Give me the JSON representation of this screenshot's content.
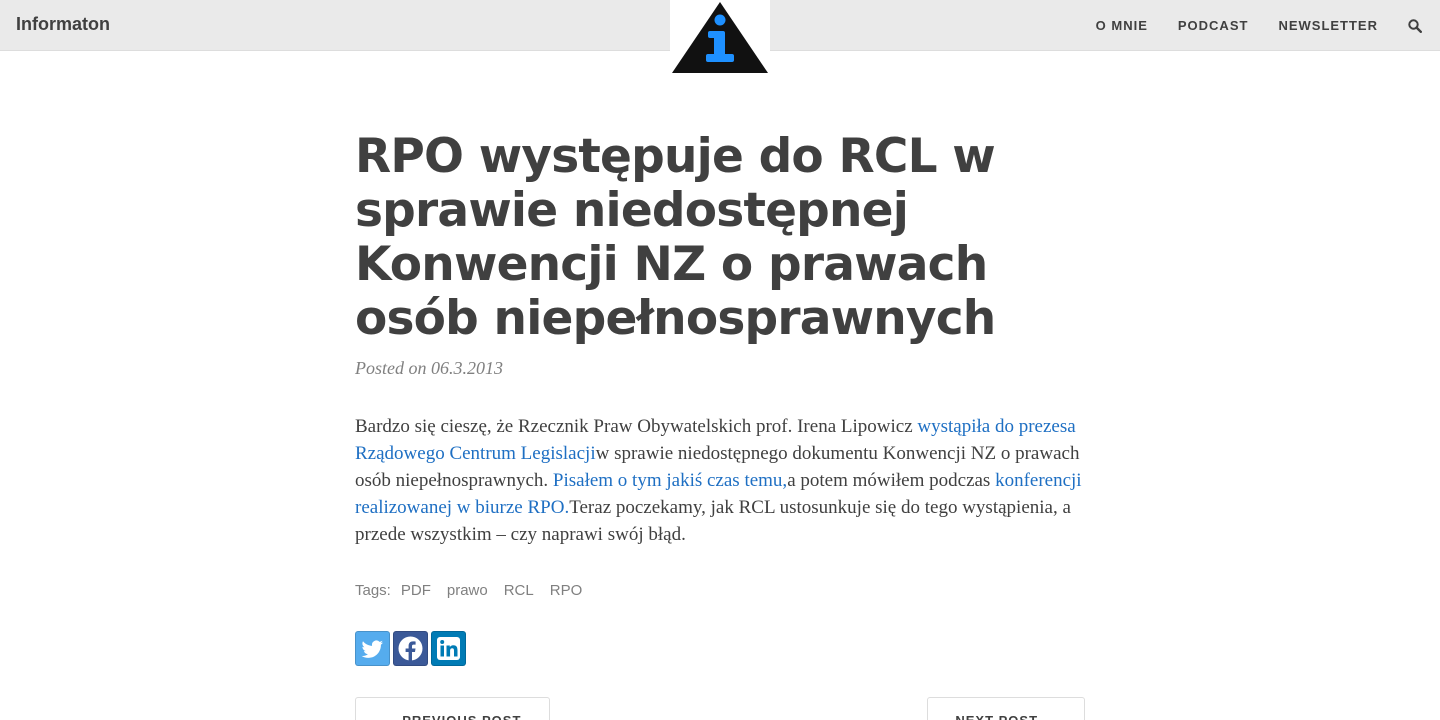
{
  "header": {
    "brand": "Informaton",
    "nav": [
      "O MNIE",
      "PODCAST",
      "NEWSLETTER"
    ]
  },
  "post": {
    "title": "RPO występuje do RCL w sprawie niedostępnej Konwencji NZ o prawach osób niepełnosprawnych",
    "meta": "Posted on 06.3.2013",
    "body": {
      "t1": "Bardzo się cieszę, że Rzecznik Praw Obywatelskich prof. Irena Lipowicz ",
      "l1": "wystąpiła do prezesa Rządowego Centrum Legislacji",
      "t2": "w sprawie niedostępnego dokumentu Konwencji NZ o prawach osób niepełnosprawnych. ",
      "l2": "Pisałem o tym jakiś czas temu,",
      "t3": "a potem mówiłem podczas ",
      "l3": "konferencji realizowanej w biurze RPO.",
      "t4": "Teraz poczekamy, jak RCL ustosunkuje się do tego wystąpienia, a przede wszystkim – czy naprawi swój błąd."
    },
    "tags_label": "Tags:",
    "tags": [
      "PDF",
      "prawo",
      "RCL",
      "RPO"
    ]
  },
  "share": [
    "twitter-icon",
    "facebook-icon",
    "linkedin-icon"
  ],
  "pager": {
    "prev": "← PREVIOUS POST",
    "next": "NEXT POST →"
  },
  "colors": {
    "header_bg": "#eaeaea",
    "link": "#1e6fc3",
    "text": "#404040",
    "logo_accent": "#1e90ff"
  }
}
